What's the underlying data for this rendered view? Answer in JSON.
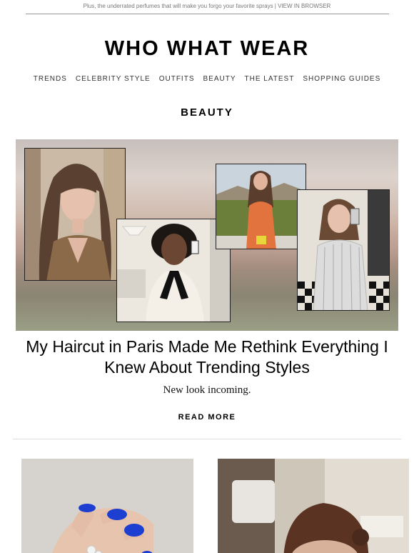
{
  "preheader": {
    "text": "Plus, the underrated perfumes that will make you forgo your favorite sprays | ",
    "view_in_browser": "VIEW IN BROWSER"
  },
  "brand": {
    "logo_text": "WHO WHAT WEAR"
  },
  "nav": {
    "items": [
      {
        "label": "TRENDS"
      },
      {
        "label": "CELEBRITY STYLE"
      },
      {
        "label": "OUTFITS"
      },
      {
        "label": "BEAUTY"
      },
      {
        "label": "THE LATEST"
      },
      {
        "label": "SHOPPING GUIDES"
      }
    ]
  },
  "section": {
    "title": "BEAUTY"
  },
  "feature": {
    "headline": "My Haircut in Paris Made Me Rethink Everything I Knew About Trending Styles",
    "dek": "New look incoming.",
    "read_more": "READ MORE"
  },
  "colors": {
    "text": "#111111",
    "muted": "#777777",
    "rule": "#dddddd",
    "nail_blue": "#1c3fd1"
  }
}
